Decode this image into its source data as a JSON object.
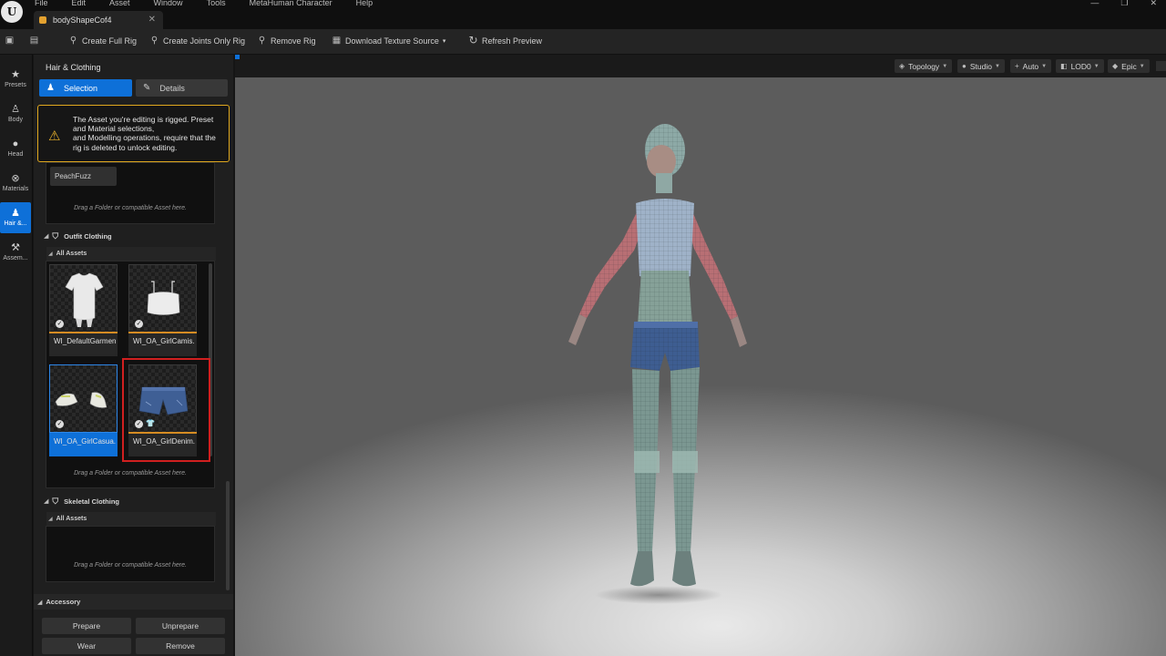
{
  "menu": [
    "File",
    "Edit",
    "Asset",
    "Window",
    "Tools",
    "MetaHuman Character",
    "Help"
  ],
  "tab": {
    "title": "bodyShapeCof4"
  },
  "toolbar": {
    "create_full_rig": "Create Full Rig",
    "create_joints_only_rig": "Create Joints Only Rig",
    "remove_rig": "Remove Rig",
    "download_texture_source": "Download Texture Source",
    "refresh_preview": "Refresh Preview"
  },
  "rail": [
    {
      "label": "Presets",
      "icon": "star-icon"
    },
    {
      "label": "Body",
      "icon": "body-icon"
    },
    {
      "label": "Head",
      "icon": "head-icon"
    },
    {
      "label": "Materials",
      "icon": "materials-icon"
    },
    {
      "label": "Hair &...",
      "icon": "hair-clothing-icon"
    },
    {
      "label": "Assem...",
      "icon": "assembly-icon"
    }
  ],
  "panel": {
    "title": "Hair & Clothing",
    "selection_tab": "Selection",
    "details_tab": "Details",
    "warning": "The Asset you're editing is rigged. Preset and Material selections,\nand Modelling operations, require that the rig is deleted to unlock editing.",
    "peachfuzz_chip": "PeachFuzz",
    "drop_hint": "Drag a Folder or compatible Asset here.",
    "outfit_section": "Outfit Clothing",
    "all_assets": "All Assets",
    "skeletal_section": "Skeletal Clothing",
    "accessory_section": "Accessory",
    "tiles": [
      {
        "label": "WI_DefaultGarment",
        "icon": "tshirt-icon"
      },
      {
        "label": "WI_OA_GirlCamis...",
        "icon": "camisole-icon"
      },
      {
        "label": "WI_OA_GirlCasua...",
        "icon": "sneakers-icon"
      },
      {
        "label": "WI_OA_GirlDenim...",
        "icon": "denim-shorts-icon"
      }
    ],
    "buttons": {
      "prepare": "Prepare",
      "unprepare": "Unprepare",
      "wear": "Wear",
      "remove": "Remove"
    }
  },
  "viewport": {
    "topology": "Topology",
    "studio": "Studio",
    "auto": "Auto",
    "lod": "LOD0",
    "quality": "Epic"
  },
  "colors": {
    "accent": "#0e70d8",
    "warning": "#e0a81e",
    "highlight": "#d01f1f"
  }
}
